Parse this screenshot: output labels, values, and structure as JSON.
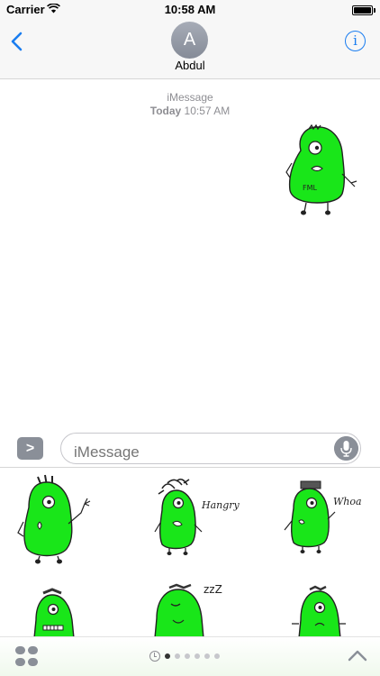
{
  "status_bar": {
    "carrier": "Carrier",
    "time": "10:58 AM"
  },
  "nav": {
    "avatar_initial": "A",
    "contact_name": "Abdul",
    "info_label": "i"
  },
  "conversation": {
    "service": "iMessage",
    "date_label": "Today",
    "time": "10:57 AM"
  },
  "compose": {
    "placeholder": "iMessage",
    "apps_label": ">"
  },
  "stickers": [
    {
      "caption": "",
      "name": "sticker-waving"
    },
    {
      "caption": "Hangry",
      "name": "sticker-hangry"
    },
    {
      "caption": "Whoa",
      "name": "sticker-whoa"
    },
    {
      "caption": "",
      "name": "sticker-teeth"
    },
    {
      "caption": "zzZ",
      "name": "sticker-sleepy"
    },
    {
      "caption": "",
      "name": "sticker-sad"
    }
  ],
  "sent_sticker": {
    "caption": "FML"
  },
  "drawer": {
    "page_count": 6,
    "active_page": 1
  },
  "colors": {
    "accent": "#1a7df0",
    "monster_green": "#19e619",
    "outline": "#222222"
  }
}
